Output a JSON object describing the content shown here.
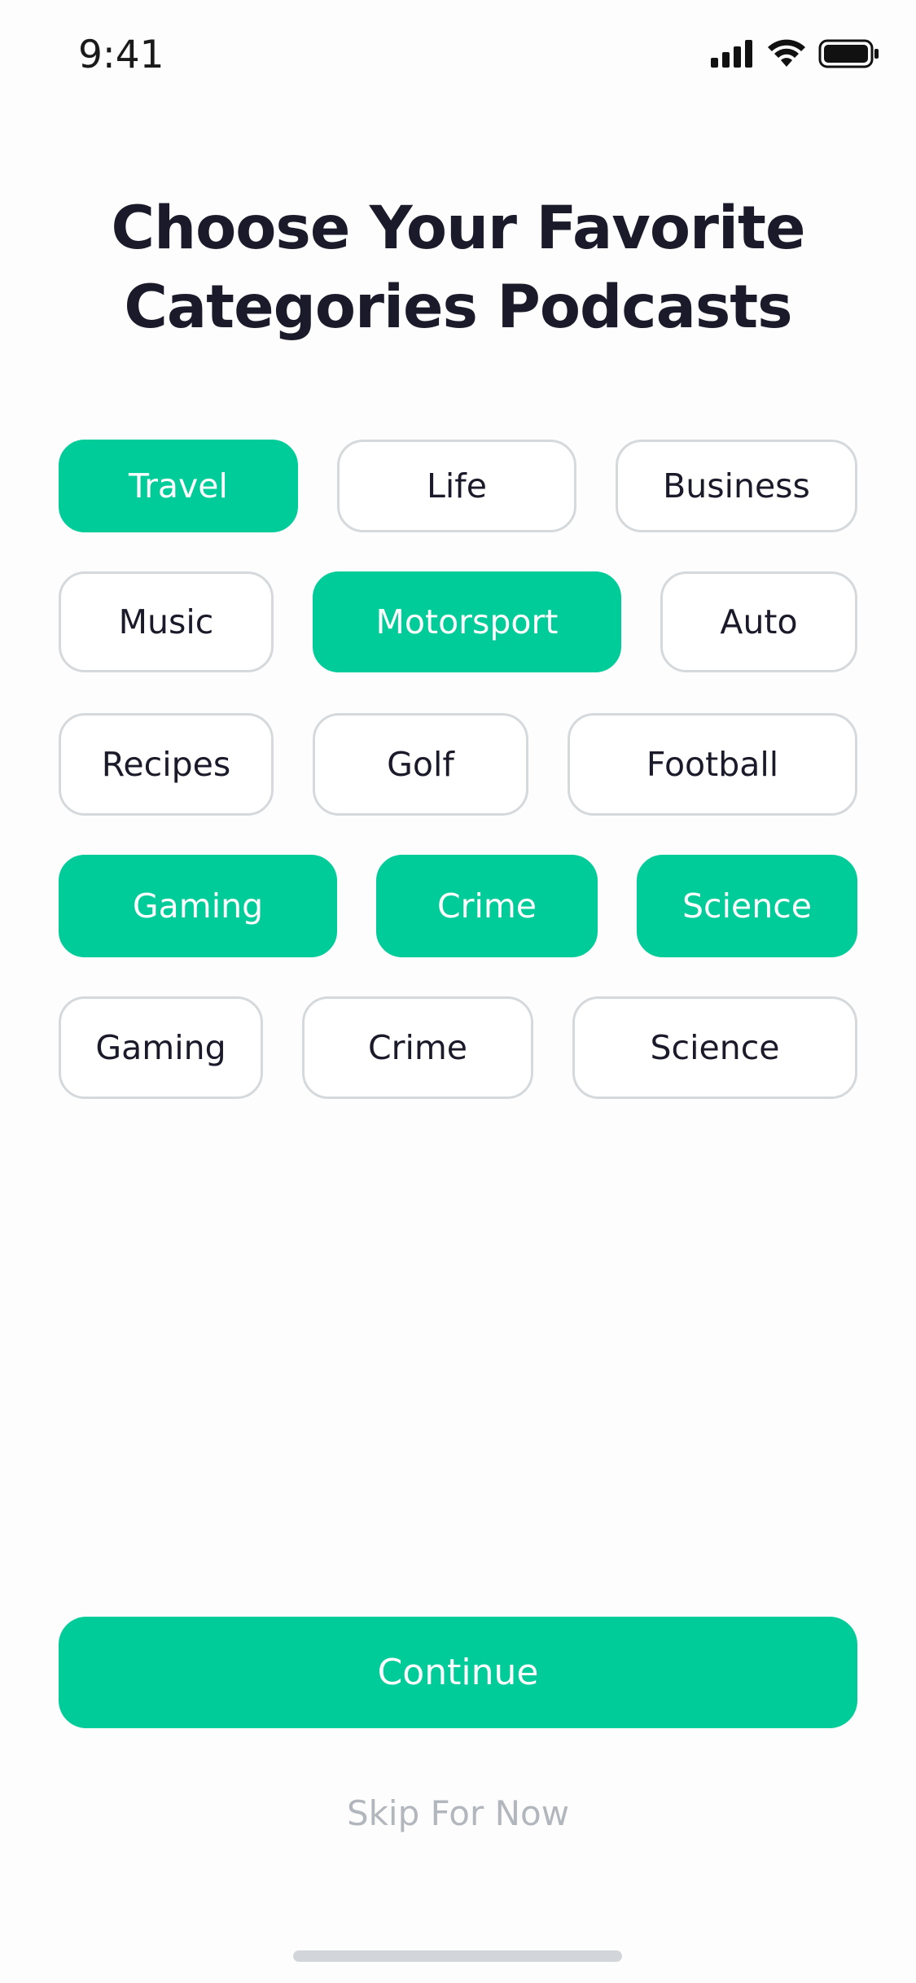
{
  "status_bar": {
    "time": "9:41",
    "icons": [
      "cellular-signal-icon",
      "wifi-icon",
      "battery-icon"
    ]
  },
  "title": {
    "line1": "Choose Your Favorite",
    "line2": "Categories Podcasts"
  },
  "colors": {
    "accent": "#00cc99",
    "chip_border": "#d6d9dc",
    "title_text": "#1a1a2a",
    "skip_text": "#b2b6bd"
  },
  "categories": [
    [
      {
        "label": "Travel",
        "selected": true
      },
      {
        "label": "Life",
        "selected": false
      },
      {
        "label": "Business",
        "selected": false
      }
    ],
    [
      {
        "label": "Music",
        "selected": false
      },
      {
        "label": "Motorsport",
        "selected": true
      },
      {
        "label": "Auto",
        "selected": false
      }
    ],
    [
      {
        "label": "Recipes",
        "selected": false
      },
      {
        "label": "Golf",
        "selected": false
      },
      {
        "label": "Football",
        "selected": false
      }
    ],
    [
      {
        "label": "Gaming",
        "selected": true
      },
      {
        "label": "Crime",
        "selected": true
      },
      {
        "label": "Science",
        "selected": true
      }
    ],
    [
      {
        "label": "Gaming",
        "selected": false
      },
      {
        "label": "Crime",
        "selected": false
      },
      {
        "label": "Science",
        "selected": false
      }
    ]
  ],
  "actions": {
    "continue_label": "Continue",
    "skip_label": "Skip For Now"
  }
}
